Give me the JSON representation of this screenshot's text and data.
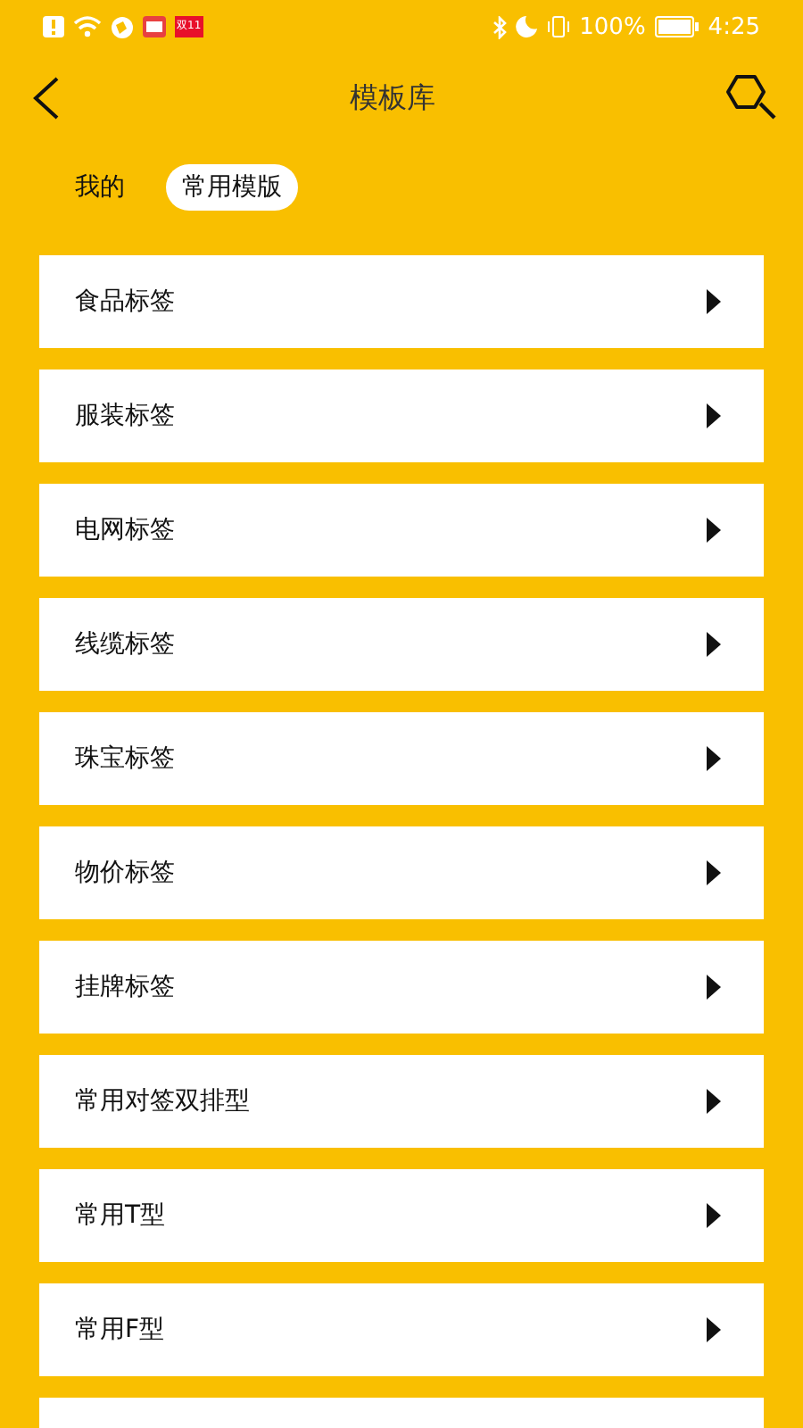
{
  "status_bar": {
    "battery_text": "100%",
    "time": "4:25",
    "notification_badge": "双11"
  },
  "header": {
    "title": "模板库"
  },
  "tabs": [
    {
      "label": "我的",
      "selected": false
    },
    {
      "label": "常用模版",
      "selected": true
    }
  ],
  "templates": [
    {
      "label": "食品标签"
    },
    {
      "label": "服装标签"
    },
    {
      "label": "电网标签"
    },
    {
      "label": "线缆标签"
    },
    {
      "label": "珠宝标签"
    },
    {
      "label": "物价标签"
    },
    {
      "label": "挂牌标签"
    },
    {
      "label": "常用对签双排型"
    },
    {
      "label": "常用T型"
    },
    {
      "label": "常用F型"
    }
  ]
}
